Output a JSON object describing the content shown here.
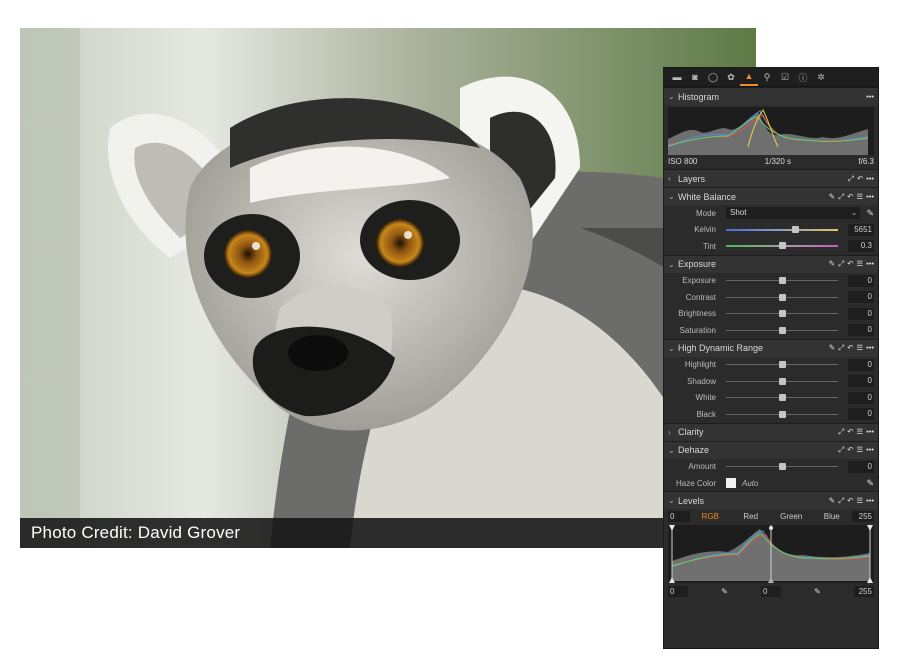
{
  "photo": {
    "credit": "Photo Credit: David Grover"
  },
  "toolbar": {
    "tools": [
      "library-icon",
      "camera-icon",
      "color-icon",
      "layers-tool-icon",
      "exposure-tool-icon",
      "loupe-icon",
      "metadata-icon",
      "info-icon",
      "settings-icon"
    ],
    "active_index": 4
  },
  "histogram": {
    "title": "Histogram",
    "iso": "ISO 800",
    "shutter": "1/320 s",
    "aperture": "f/6.3"
  },
  "layers": {
    "title": "Layers"
  },
  "white_balance": {
    "title": "White Balance",
    "mode_label": "Mode",
    "mode_value": "Shot",
    "kelvin_label": "Kelvin",
    "kelvin_value": "5651",
    "kelvin_pos": 0.62,
    "tint_label": "Tint",
    "tint_value": "0.3",
    "tint_pos": 0.5
  },
  "exposure": {
    "title": "Exposure",
    "rows": [
      {
        "label": "Exposure",
        "value": "0"
      },
      {
        "label": "Contrast",
        "value": "0"
      },
      {
        "label": "Brightness",
        "value": "0"
      },
      {
        "label": "Saturation",
        "value": "0"
      }
    ]
  },
  "hdr": {
    "title": "High Dynamic Range",
    "rows": [
      {
        "label": "Highlight",
        "value": "0"
      },
      {
        "label": "Shadow",
        "value": "0"
      },
      {
        "label": "White",
        "value": "0"
      },
      {
        "label": "Black",
        "value": "0"
      }
    ]
  },
  "clarity": {
    "title": "Clarity"
  },
  "dehaze": {
    "title": "Dehaze",
    "amount_label": "Amount",
    "amount_value": "0",
    "haze_label": "Haze Color",
    "haze_value": "Auto"
  },
  "levels": {
    "title": "Levels",
    "input_low": "0",
    "input_high": "255",
    "tabs": [
      "RGB",
      "Red",
      "Green",
      "Blue"
    ],
    "active_tab": 0,
    "output_low": "0",
    "output_mid": "0",
    "output_high": "255"
  },
  "colors": {
    "accent": "#f08a24",
    "panel_bg": "#2b2b2b"
  }
}
